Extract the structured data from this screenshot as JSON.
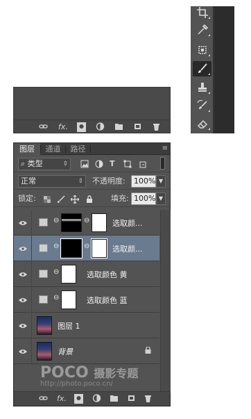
{
  "layers_panel": {
    "tabs": [
      "图层",
      "通道",
      "路径"
    ],
    "active_tab": 0,
    "panel_menu_icon": "≡",
    "filter_kind_label": "类型",
    "blend_mode": "正常",
    "opacity_label": "不透明度:",
    "opacity_value": "100%",
    "lock_label": "锁定:",
    "fill_label": "填充:",
    "fill_value": "100%",
    "layers": [
      {
        "name": "选取颜...",
        "type": "selective-color",
        "mask": "black-white-top",
        "selected": false,
        "visible": true
      },
      {
        "name": "选取颜...",
        "type": "selective-color",
        "mask": "black",
        "selected": true,
        "visible": true
      },
      {
        "name": "选取颜色 黄",
        "type": "selective-color",
        "mask": "white",
        "selected": false,
        "visible": true
      },
      {
        "name": "选取颜色 蓝",
        "type": "selective-color",
        "mask": "white",
        "selected": false,
        "visible": true
      },
      {
        "name": "图层 1",
        "type": "pixel",
        "selected": false,
        "visible": true
      },
      {
        "name": "背景",
        "type": "background",
        "locked": true,
        "selected": false,
        "visible": true
      }
    ]
  },
  "mini_panel": {
    "footer_icons": [
      "link-icon",
      "fx-icon",
      "mask-icon",
      "adjustment-icon",
      "folder-icon",
      "new-layer-icon",
      "trash-icon"
    ]
  },
  "bottom_bar": {
    "fx_label": "fx."
  },
  "watermark": {
    "brand": "POCO",
    "brand_cn": "摄影专题",
    "url": "http://photo.poco.cn/"
  },
  "tools": [
    "crop-icon",
    "eyedropper-icon",
    "spot-heal-icon",
    "brush-icon",
    "stamp-icon",
    "history-brush-icon",
    "eraser-icon"
  ],
  "colors": {
    "panel_bg": "#535353",
    "selected_layer": "#6a7a8f",
    "tab_bar": "#3c3c3c"
  }
}
